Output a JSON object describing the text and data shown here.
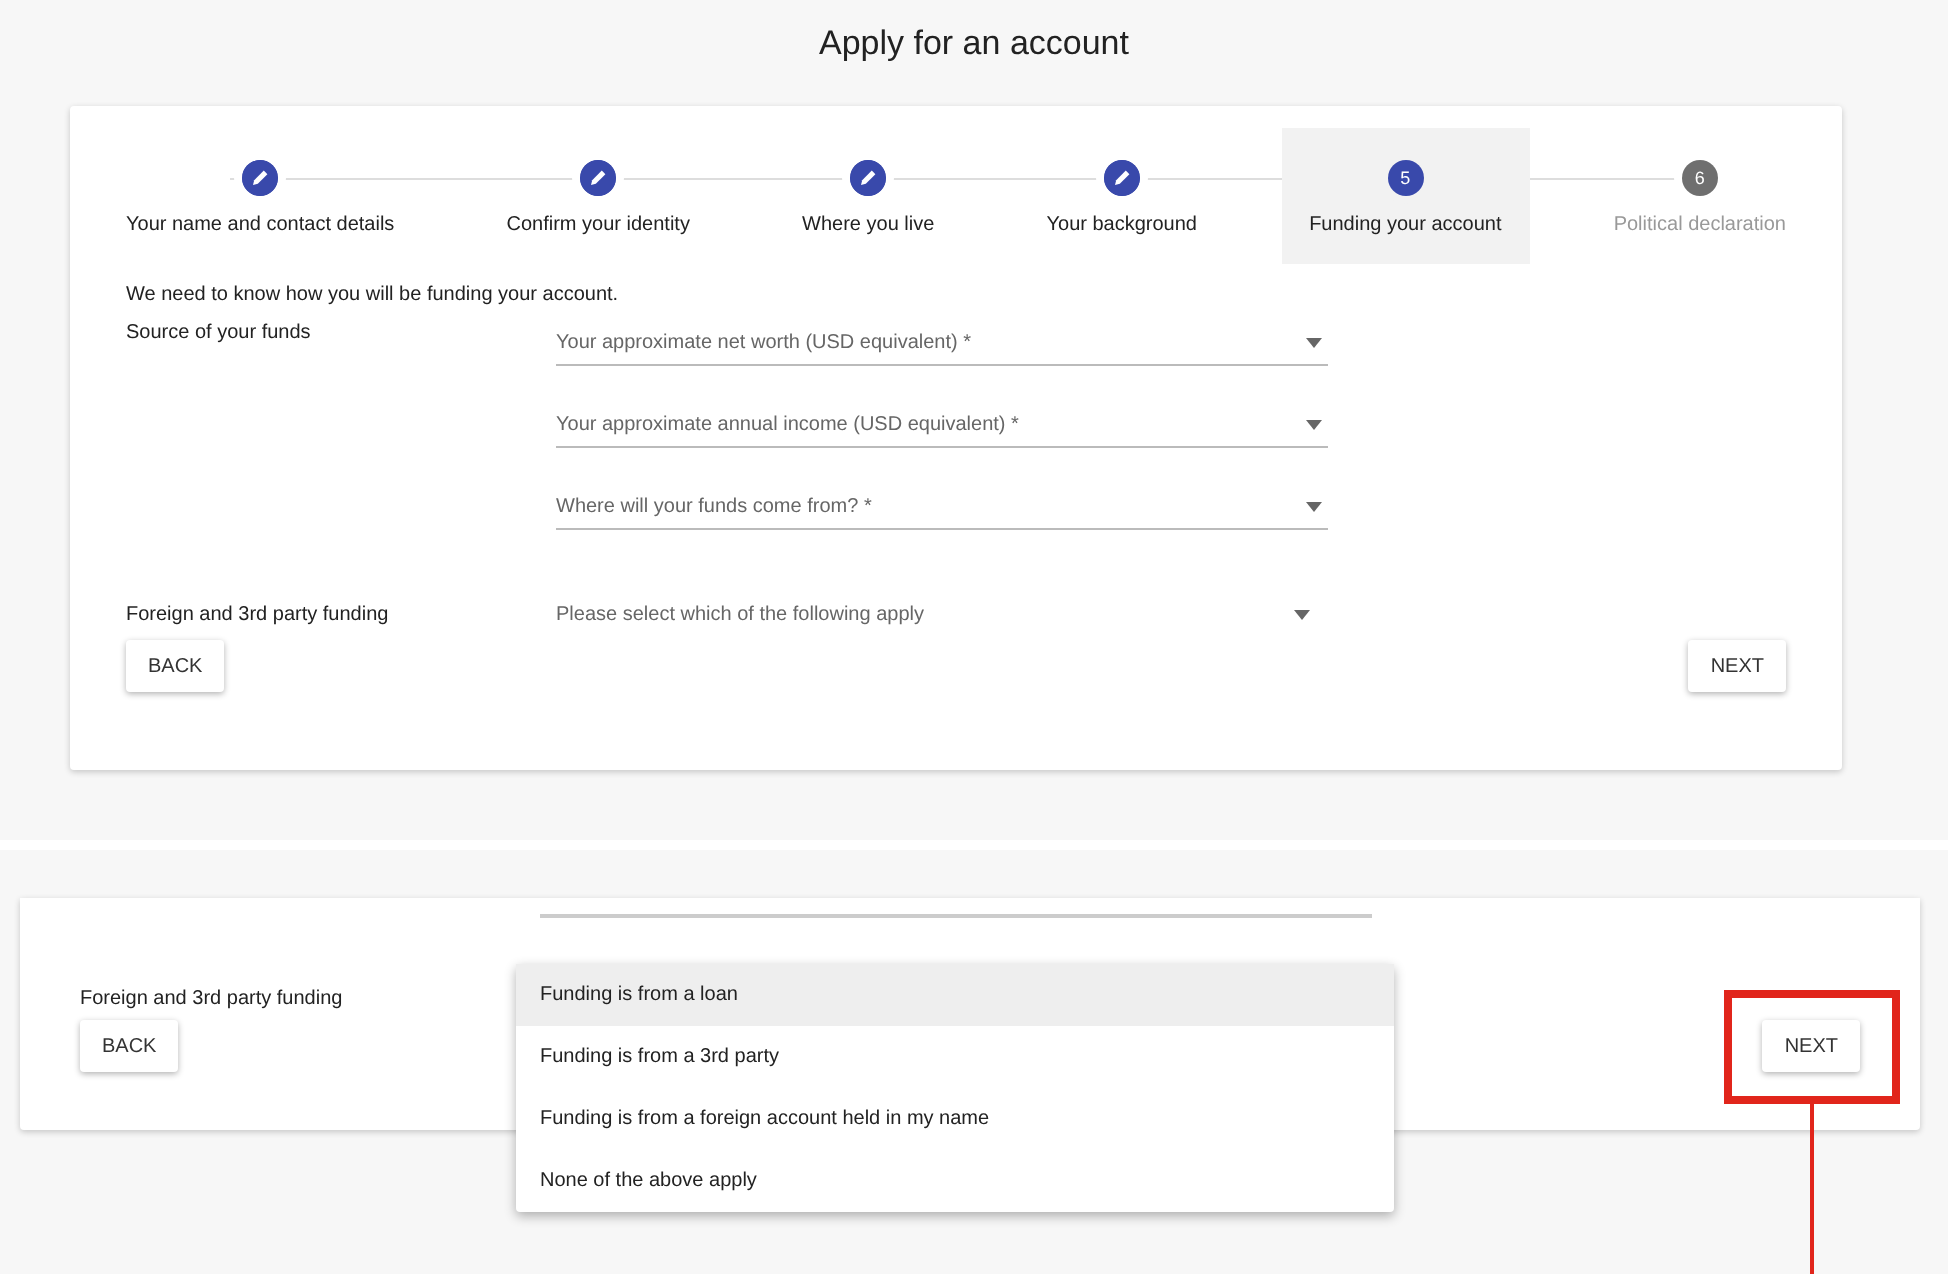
{
  "title": "Apply for an account",
  "steps": [
    {
      "label": "Your name and contact details",
      "completed": true,
      "selected": false
    },
    {
      "label": "Confirm your identity",
      "completed": true,
      "selected": false
    },
    {
      "label": "Where you live",
      "completed": true,
      "selected": false
    },
    {
      "label": "Your background",
      "completed": true,
      "selected": false
    },
    {
      "label": "Funding your account",
      "completed": false,
      "selected": true,
      "number": "5"
    },
    {
      "label": "Political declaration",
      "completed": false,
      "selected": false,
      "number": "6"
    }
  ],
  "intro": "We need to know how you will be funding your account.",
  "source_label": "Source of your funds",
  "source_fields": [
    {
      "placeholder": "Your approximate net worth (USD equivalent) *"
    },
    {
      "placeholder": "Your approximate annual income (USD equivalent) *"
    },
    {
      "placeholder": "Where will your funds come from? *"
    }
  ],
  "foreign_label": "Foreign and 3rd party funding",
  "foreign_field": {
    "placeholder": "Please select which of the following apply"
  },
  "back_button": "BACK",
  "next_button": "NEXT",
  "detail": {
    "foreign_label": "Foreign and 3rd party funding",
    "back_button": "BACK",
    "next_button": "NEXT",
    "options": [
      {
        "label": "Funding is from a loan",
        "selected": true
      },
      {
        "label": "Funding is from a 3rd party",
        "selected": false
      },
      {
        "label": "Funding is from a foreign account held in my name",
        "selected": false
      },
      {
        "label": "None of the above apply",
        "selected": false
      }
    ]
  }
}
